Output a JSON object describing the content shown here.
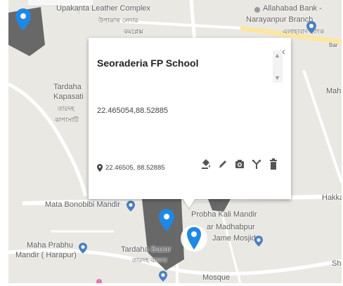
{
  "map": {
    "labels": [
      {
        "id": "upakanta",
        "text": "Upakanta Leather Complex"
      },
      {
        "id": "upakanta-bn",
        "text": "উপাকান্ত লেদার"
      },
      {
        "id": "upakanta-bn2",
        "text": "কমপ্লেক্স"
      },
      {
        "id": "allahabad",
        "text": "Allahabad Bank -"
      },
      {
        "id": "narayanpur",
        "text": "Narayanpur Branch"
      },
      {
        "id": "allahabad-bn",
        "text": "এলাহাবাদ ব্যাংক"
      },
      {
        "id": "tardaha1",
        "text": "Tardaha"
      },
      {
        "id": "kapasati",
        "text": "Kapasati"
      },
      {
        "id": "tardaha-bn",
        "text": "তারদহ"
      },
      {
        "id": "kapasati-bn",
        "text": "কাপাসাটি"
      },
      {
        "id": "mah",
        "text": "Mah"
      },
      {
        "id": "hakka",
        "text": "Hakka"
      },
      {
        "id": "mata-bonobibi",
        "text": "Mata Bonobibi Mandir"
      },
      {
        "id": "probha-kali",
        "text": "Probha Kali Mandir"
      },
      {
        "id": "madhabpur",
        "text": "ar Madhabpur"
      },
      {
        "id": "jame-mosjid",
        "text": "Jame Mosjid"
      },
      {
        "id": "maha-prabhu",
        "text": "Maha Prabhu"
      },
      {
        "id": "mandir-harapur",
        "text": "Mandir ( Harapur)"
      },
      {
        "id": "tardaha-bazar",
        "text": "Tardaha Bazar"
      },
      {
        "id": "tardaha-bazar-bn",
        "text": "তারদহ বাজার"
      },
      {
        "id": "mosque",
        "text": "Mosque"
      },
      {
        "id": "sh",
        "text": "Sh"
      },
      {
        "id": "bar",
        "text": "Bar"
      }
    ]
  },
  "popup": {
    "title": "Seoraderia FP School",
    "coordinates_text": "22.465054,88.52885",
    "location_text": "22.46505, 88.52885",
    "close_label": "×",
    "tools": [
      "paint-bucket-icon",
      "pencil-icon",
      "camera-icon",
      "directions-icon",
      "trash-icon"
    ]
  },
  "colors": {
    "map_bg": "#e9e8e3",
    "road": "#ffffff",
    "highway": "#fbe7a1",
    "polygon": "#5a5a5a",
    "pin": "#1e88e5",
    "poi": "#4a7fc4"
  }
}
